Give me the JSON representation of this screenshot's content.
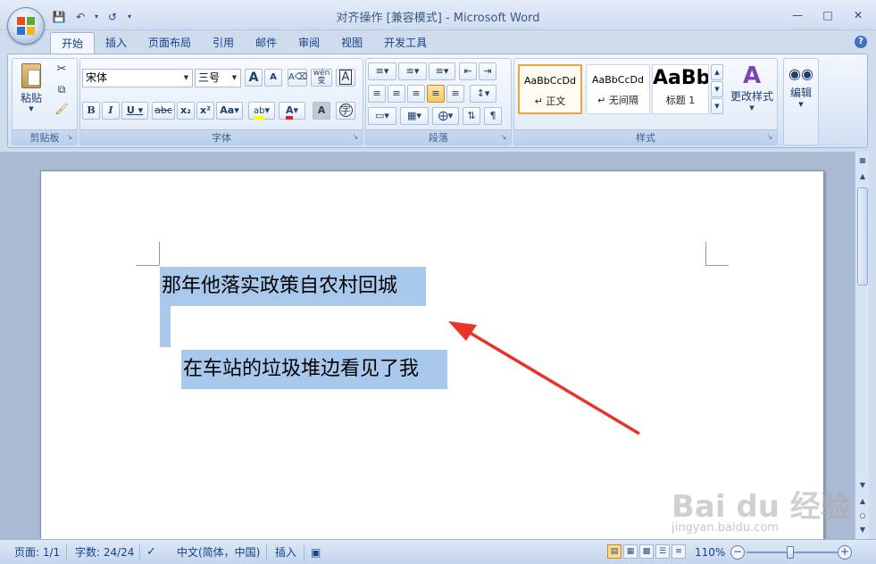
{
  "window": {
    "title": "对齐操作 [兼容模式] - Microsoft Word"
  },
  "tabs": [
    "开始",
    "插入",
    "页面布局",
    "引用",
    "邮件",
    "审阅",
    "视图",
    "开发工具"
  ],
  "ribbon": {
    "clipboard": {
      "label": "剪贴板",
      "paste": "粘贴"
    },
    "font": {
      "label": "字体",
      "font_name": "宋体",
      "font_size": "三号",
      "bold": "B",
      "italic": "I",
      "underline": "U",
      "strike": "abc",
      "subscript": "x₂",
      "superscript": "x²",
      "case": "Aa",
      "grow": "A",
      "shrink": "A",
      "font_color": "A",
      "char_shading": "A",
      "phonetic": "wén 变",
      "border_char": "A",
      "enclose": "字"
    },
    "paragraph": {
      "label": "段落"
    },
    "styles": {
      "label": "样式",
      "cards": [
        {
          "preview": "AaBbCcDd",
          "name": "↵ 正文"
        },
        {
          "preview": "AaBbCcDd",
          "name": "↵ 无间隔"
        },
        {
          "preview": "AaBb",
          "name": "标题 1"
        }
      ],
      "change_styles": "更改样式"
    },
    "editing": {
      "label": "编辑"
    }
  },
  "document": {
    "lines": [
      "那年他落实政策自农村回城",
      "在车站的垃圾堆边看见了我"
    ]
  },
  "statusbar": {
    "page": "页面: 1/1",
    "words": "字数: 24/24",
    "language": "中文(简体，中国)",
    "mode": "插入",
    "zoom": "110%"
  },
  "watermark": {
    "brand": "Bai du 经验",
    "url": "jingyan.baidu.com"
  },
  "colors": {
    "selection": "#a8c8ec",
    "arrow": "#e8332a",
    "accent": "#15428b"
  }
}
